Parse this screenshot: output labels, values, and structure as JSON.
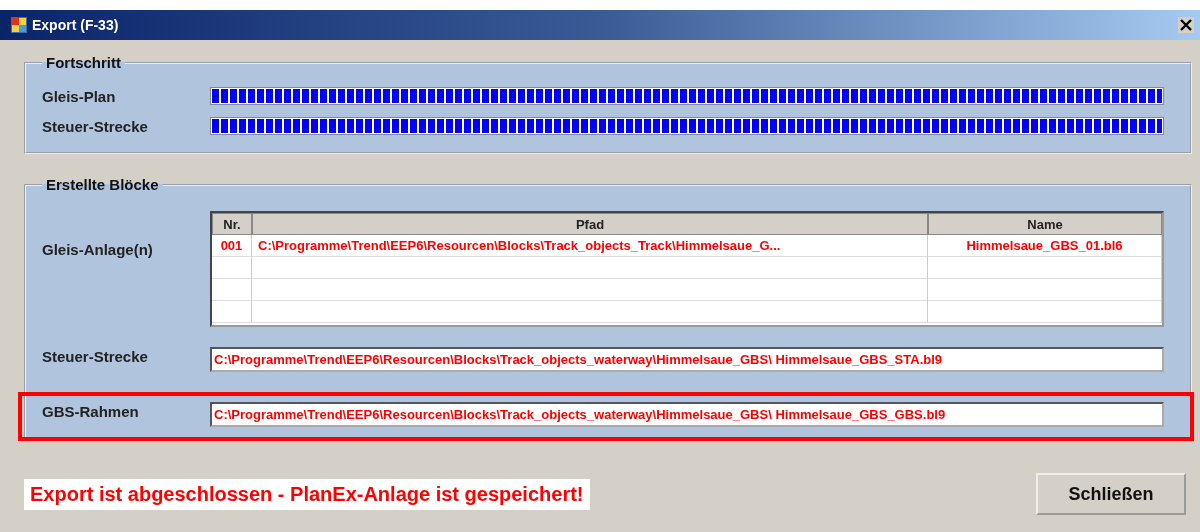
{
  "window": {
    "title": "Export (F-33)"
  },
  "progress": {
    "title": "Fortschritt",
    "rows": [
      {
        "label": "Gleis-Plan",
        "level": 1
      },
      {
        "label": "Steuer-Strecke",
        "level": 1
      }
    ]
  },
  "blocks": {
    "title": "Erstellte Blöcke",
    "table_label": "Gleis-Anlage(n)",
    "table": {
      "columns": [
        "Nr.",
        "Pfad",
        "Name"
      ],
      "rows": [
        [
          "001",
          "C:\\Programme\\Trend\\EEP6\\Resourcen\\Blocks\\Track_objects_Track\\Himmelsaue_G...",
          "Himmelsaue_GBS_01.bl6"
        ]
      ]
    },
    "fields": [
      {
        "label": "Steuer-Strecke",
        "value": "C:\\Programme\\Trend\\EEP6\\Resourcen\\Blocks\\Track_objects_waterway\\Himmelsaue_GBS\\ Himmelsaue_GBS_STA.bl9",
        "highlighted": false
      },
      {
        "label": "GBS-Rahmen",
        "value": "C:\\Programme\\Trend\\EEP6\\Resourcen\\Blocks\\Track_objects_waterway\\Himmelsaue_GBS\\ Himmelsaue_GBS_GBS.bl9",
        "highlighted": true
      }
    ]
  },
  "status": "Export ist abgeschlossen - PlanEx-Anlage ist gespeichert!",
  "buttons": [
    {
      "label": "Schließen"
    }
  ]
}
